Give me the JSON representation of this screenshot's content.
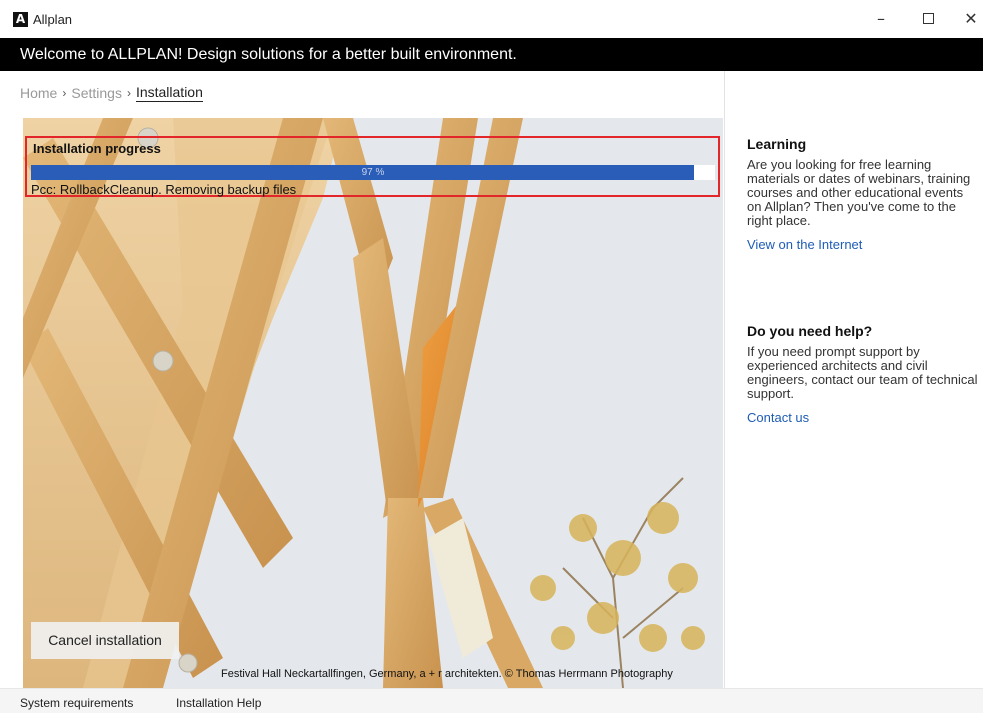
{
  "window": {
    "title": "Allplan",
    "logo_glyph": "A",
    "minimize": "–",
    "close": "✕"
  },
  "banner": {
    "text": "Welcome to ALLPLAN! Design solutions for a better built environment."
  },
  "breadcrumb": {
    "items": [
      "Home",
      "Settings",
      "Installation"
    ],
    "separator": "›"
  },
  "progress": {
    "title": "Installation progress",
    "percent": 97,
    "percent_label": "97 %",
    "status": "Pcc: RollbackCleanup. Removing backup files",
    "color": "#2a5db8"
  },
  "image": {
    "caption": "Festival Hall Neckartallfingen, Germany, a + r architekten. © Thomas Herrmann Photography"
  },
  "cancel_button": {
    "label": "Cancel installation"
  },
  "sidebar": {
    "learning": {
      "title": "Learning",
      "body": "Are you looking for free learning materials or dates of webinars, training courses and other educational events on Allplan? Then you've come to the right place.",
      "link": "View on the Internet"
    },
    "help": {
      "title": "Do you need help?",
      "body": "If you need prompt support by experienced architects and civil engineers, contact our team of technical support.",
      "link": "Contact us"
    },
    "link_color": "#1f5cb5"
  },
  "footer": {
    "system_requirements": "System requirements",
    "installation_help": "Installation Help"
  }
}
